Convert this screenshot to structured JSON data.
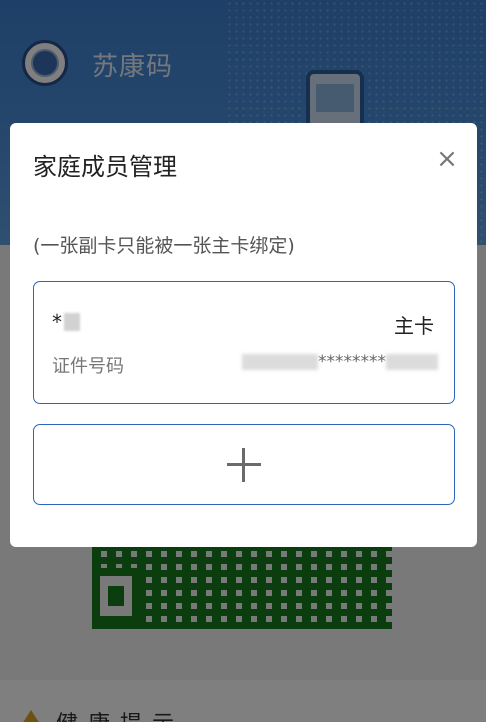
{
  "app": {
    "title": "苏康码"
  },
  "tip": {
    "label": "健康提示"
  },
  "modal": {
    "title": "家庭成员管理",
    "close_glyph": "×",
    "note": "(一张副卡只能被一张主卡绑定)",
    "member": {
      "name_prefix": "*",
      "role": "主卡",
      "id_label": "证件号码",
      "id_masked": "********"
    },
    "add_button_icon": "plus-icon"
  },
  "colors": {
    "header_blue": "#4b8fd9",
    "card_border": "#2a66b8",
    "qr_green": "#167a1f"
  }
}
